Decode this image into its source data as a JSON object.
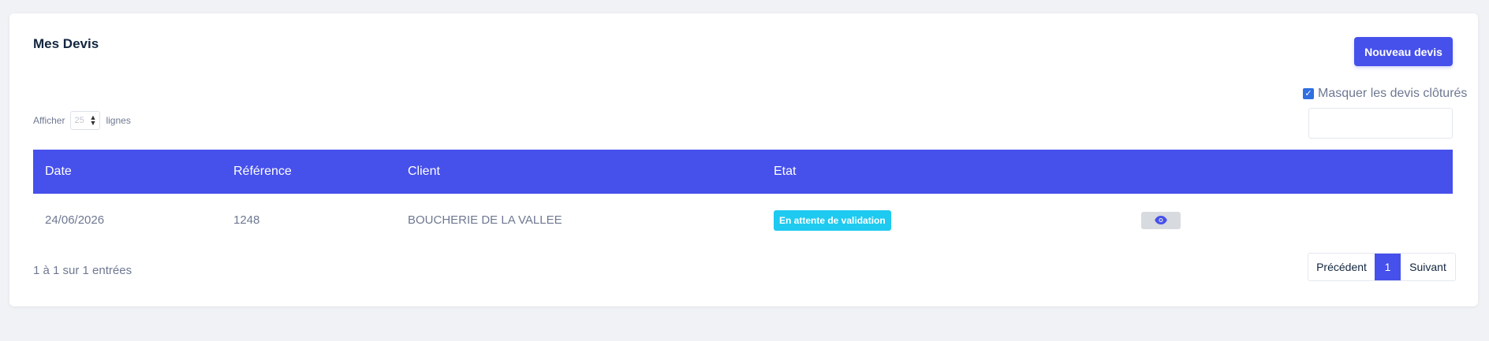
{
  "card": {
    "title": "Mes Devis",
    "new_button": "Nouveau devis"
  },
  "filters": {
    "hide_closed_label": "Masquer les devis clôturés",
    "hide_closed_checked": true,
    "show_prefix": "Afficher",
    "show_value": "25",
    "show_suffix": "lignes",
    "search_value": ""
  },
  "table": {
    "headers": [
      "Date",
      "Référence",
      "Client",
      "Etat",
      ""
    ],
    "rows": [
      {
        "date": "24/06/2026",
        "reference": "1248",
        "client": "BOUCHERIE DE LA VALLEE",
        "status": "En attente de validation"
      }
    ]
  },
  "footer": {
    "info": "1 à 1 sur 1 entrées",
    "prev": "Précédent",
    "current_page": "1",
    "next": "Suivant"
  },
  "colors": {
    "accent": "#4650eb",
    "badge": "#1ecaf0",
    "background": "#f0f2f5"
  },
  "icons": {
    "view": "eye-icon",
    "checkbox": "check-icon",
    "select_arrows": "sort-arrows-icon"
  }
}
